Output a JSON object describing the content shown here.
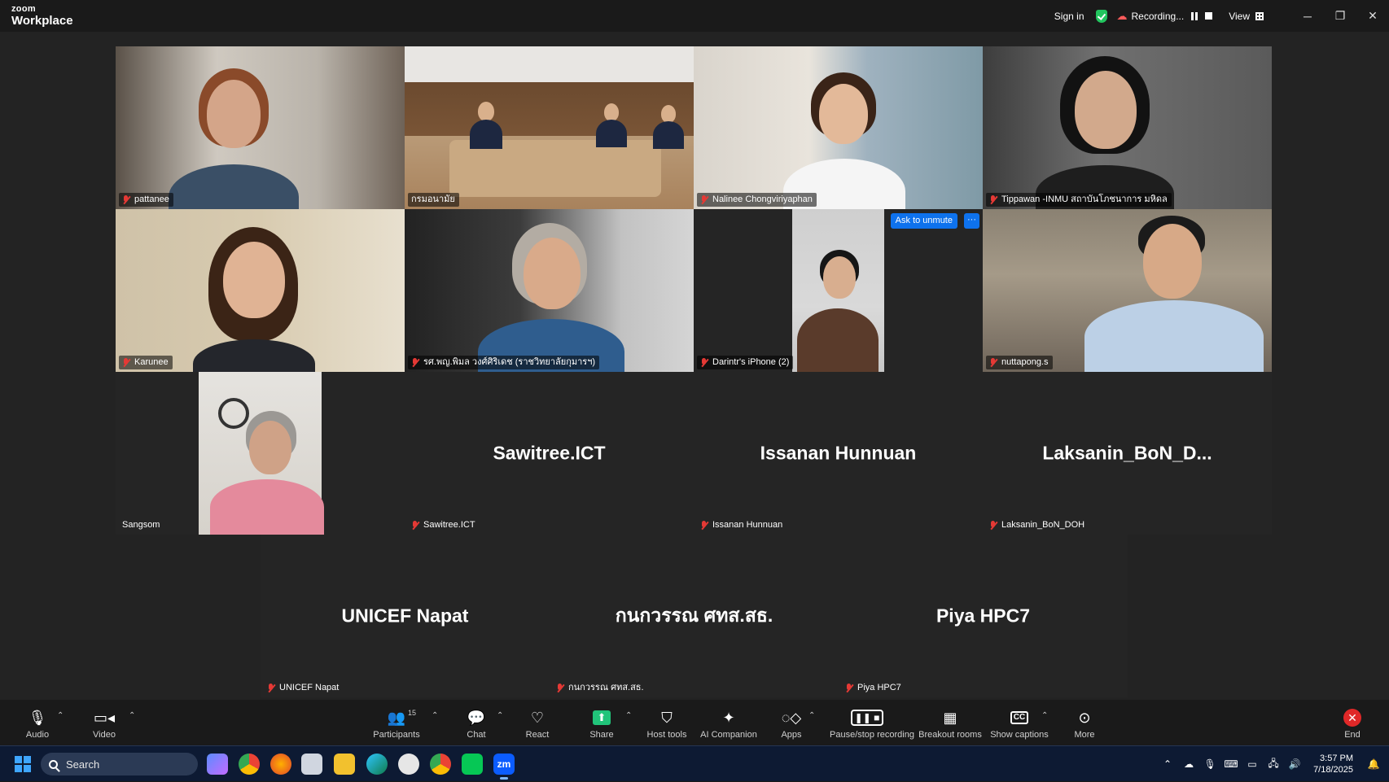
{
  "app": {
    "brand_small": "zoom",
    "brand_large": "Workplace"
  },
  "titlebar": {
    "sign_in": "Sign in",
    "recording": "Recording...",
    "view": "View"
  },
  "gallery": {
    "tiles": [
      {
        "name": "pattanee",
        "type": "video",
        "muted": true
      },
      {
        "name": "กรมอนามัย",
        "type": "video",
        "muted": false,
        "active_speaker": true
      },
      {
        "name": "Nalinee Chongviriyaphan",
        "type": "video",
        "muted": true
      },
      {
        "name": "Tippawan -INMU สถาบันโภชนาการ มหิดล",
        "type": "video",
        "muted": true
      },
      {
        "name": "Karunee",
        "type": "video",
        "muted": true
      },
      {
        "name": "รศ.พญ.พิมล วงศ์ศิริเดช (ราชวิทยาลัยกุมารฯ)",
        "type": "video",
        "muted": true
      },
      {
        "name": "Darintr's iPhone (2)",
        "type": "video",
        "muted": true,
        "hover_button": "Ask to unmute"
      },
      {
        "name": "nuttapong.s",
        "type": "video",
        "muted": true
      },
      {
        "name": "Sangsom",
        "type": "video",
        "muted": false
      },
      {
        "name": "Sawitree.ICT",
        "type": "avatar",
        "display": "Sawitree.ICT",
        "muted": true
      },
      {
        "name": "Issanan Hunnuan",
        "type": "avatar",
        "display": "Issanan Hunnuan",
        "muted": true
      },
      {
        "name": "Laksanin_BoN_DOH",
        "type": "avatar",
        "display": "Laksanin_BoN_D...",
        "muted": true
      },
      {
        "name": "UNICEF Napat",
        "type": "avatar",
        "display": "UNICEF Napat",
        "muted": true
      },
      {
        "name": "กนกวรรณ ศทส.สธ.",
        "type": "avatar",
        "display": "กนกวรรณ ศทส.สธ.",
        "muted": true
      },
      {
        "name": "Piya HPC7",
        "type": "avatar",
        "display": "Piya HPC7",
        "muted": true
      }
    ]
  },
  "toolbar": {
    "audio": "Audio",
    "video": "Video",
    "participants": "Participants",
    "participants_count": "15",
    "chat": "Chat",
    "react": "React",
    "share": "Share",
    "host_tools": "Host tools",
    "ai_companion": "AI Companion",
    "apps": "Apps",
    "pause_recording": "Pause/stop recording",
    "breakout_rooms": "Breakout rooms",
    "show_captions": "Show captions",
    "more": "More",
    "end": "End"
  },
  "taskbar": {
    "search_placeholder": "Search",
    "time": "3:57 PM",
    "date": "7/18/2025"
  },
  "colors": {
    "accent_blue": "#0e72ed",
    "active_speaker": "#2ccf7f",
    "muted_red": "#e53935",
    "end_red": "#e02828",
    "share_green": "#21c47a"
  }
}
